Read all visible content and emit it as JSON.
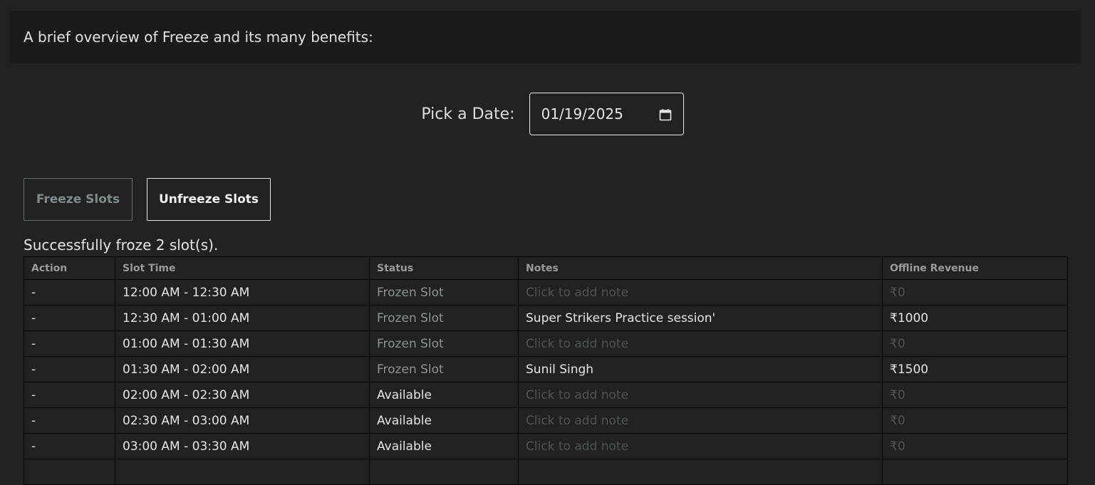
{
  "overview": {
    "text": "A brief overview of Freeze and its many benefits:"
  },
  "date_picker": {
    "label": "Pick a Date:",
    "value": "01/19/2025",
    "icon": "calendar-icon"
  },
  "buttons": {
    "freeze": "Freeze Slots",
    "unfreeze": "Unfreeze Slots"
  },
  "status_message": "Successfully froze 2 slot(s).",
  "table": {
    "headers": [
      "Action",
      "Slot Time",
      "Status",
      "Notes",
      "Offline Revenue"
    ],
    "rows": [
      {
        "action": "-",
        "slot_time": "12:00 AM - 12:30 AM",
        "status": "Frozen Slot",
        "notes": "Click to add note",
        "revenue": "₹0"
      },
      {
        "action": "-",
        "slot_time": "12:30 AM - 01:00 AM",
        "status": "Frozen Slot",
        "notes": "Super Strikers Practice session'",
        "revenue": "₹1000"
      },
      {
        "action": "-",
        "slot_time": "01:00 AM - 01:30 AM",
        "status": "Frozen Slot",
        "notes": "Click to add note",
        "revenue": "₹0"
      },
      {
        "action": "-",
        "slot_time": "01:30 AM - 02:00 AM",
        "status": "Frozen Slot",
        "notes": "Sunil Singh",
        "revenue": "₹1500"
      },
      {
        "action": "-",
        "slot_time": "02:00 AM - 02:30 AM",
        "status": "Available",
        "notes": "Click to add note",
        "revenue": "₹0"
      },
      {
        "action": "-",
        "slot_time": "02:30 AM - 03:00 AM",
        "status": "Available",
        "notes": "Click to add note",
        "revenue": "₹0"
      },
      {
        "action": "-",
        "slot_time": "03:00 AM - 03:30 AM",
        "status": "Available",
        "notes": "Click to add note",
        "revenue": "₹0"
      }
    ]
  }
}
